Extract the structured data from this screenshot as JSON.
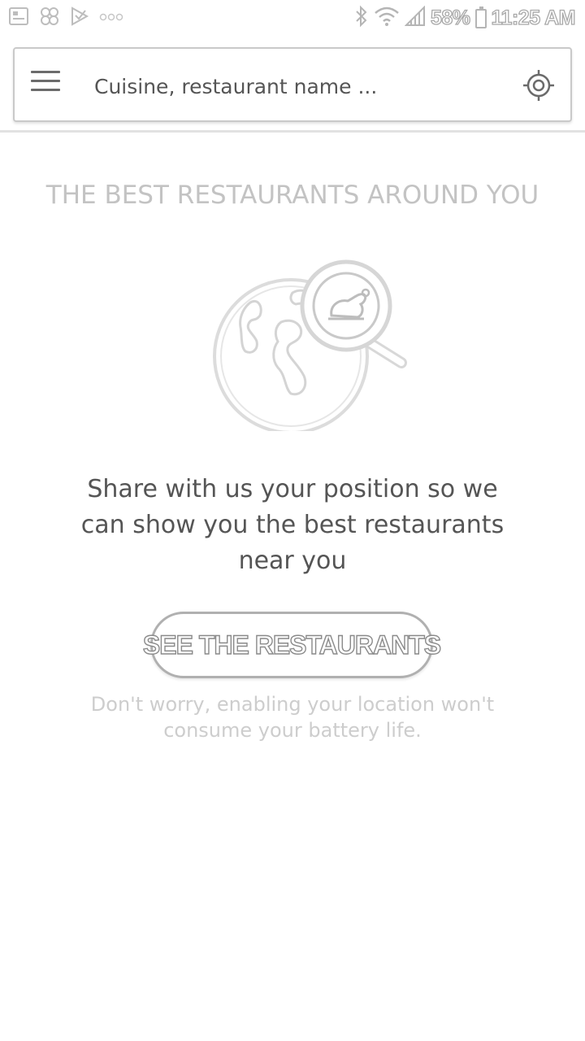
{
  "status_bar": {
    "battery": "58%",
    "time": "11:25 AM",
    "left_icons": [
      "image-notification-icon",
      "pinwheel-notification-icon",
      "check-notification-icon",
      "more-notifications-icon"
    ],
    "right_icons": [
      "bluetooth-icon",
      "wifi-icon",
      "signal-icon",
      "battery-icon"
    ]
  },
  "search": {
    "placeholder": "Cuisine, restaurant name ...",
    "menu_icon": "hamburger-menu-icon",
    "locate_icon": "crosshair-location-icon"
  },
  "main": {
    "headline": "THE BEST RESTAURANTS AROUND YOU",
    "illustration_icon": "globe-magnifier-chicken-icon",
    "message": "Share with us your position so we can show you the best restaurants near you",
    "cta_label": "SEE THE RESTAURANTS",
    "footnote": "Don't worry, enabling your location won't consume your battery life."
  },
  "colors": {
    "text_dark": "#555555",
    "text_light": "#c3c3c3",
    "border": "#c9c9c9"
  }
}
